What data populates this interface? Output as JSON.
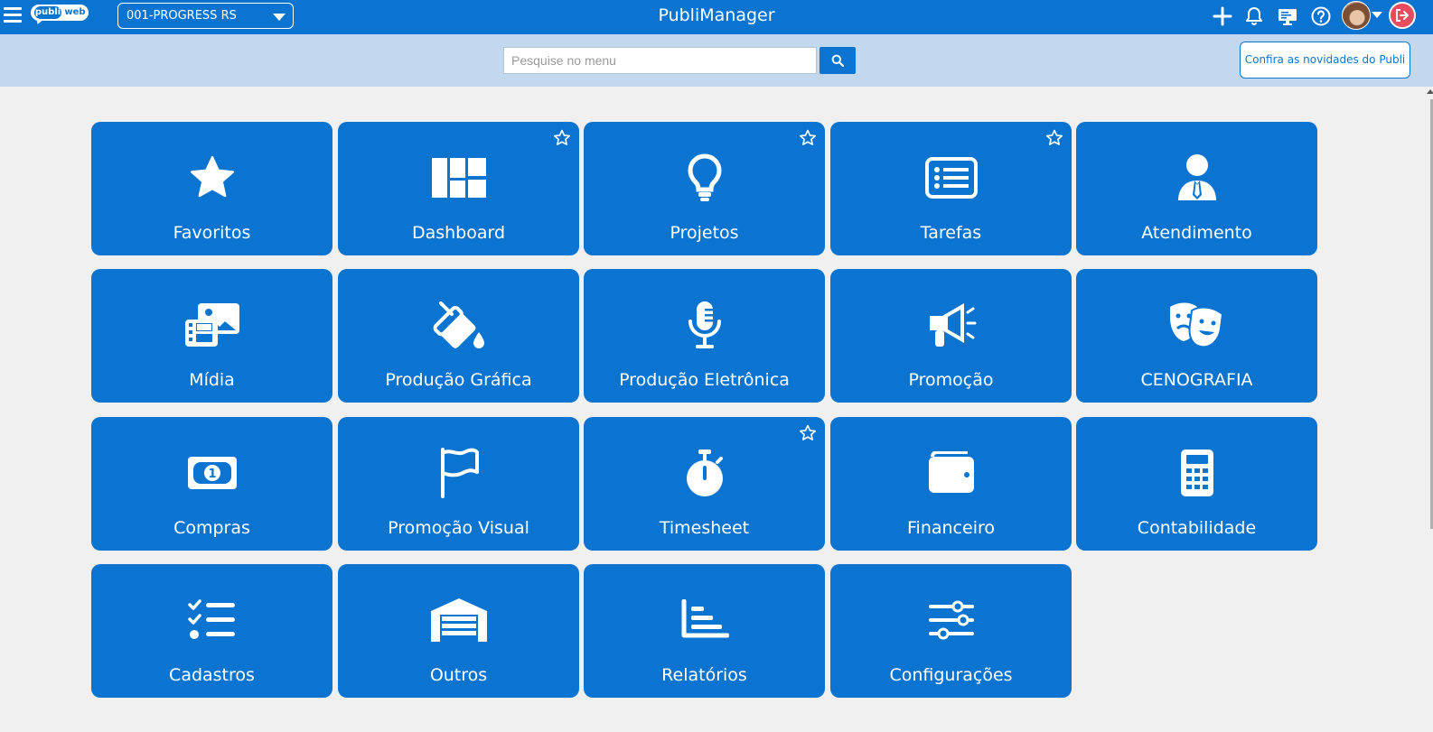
{
  "header": {
    "app_title": "PubliManager",
    "logo": {
      "part1": "publi",
      "part2": "web"
    },
    "company": "001-PROGRESS RS",
    "icons": [
      "menu-icon",
      "plus-icon",
      "bell-icon",
      "monitor-icon",
      "help-icon",
      "avatar",
      "logout-icon"
    ]
  },
  "search": {
    "placeholder": "Pesquise no menu",
    "value": ""
  },
  "news_button": "Confira as novidades do Publi",
  "colors": {
    "brand_blue": "#0a74d0",
    "search_band": "#c2d8ef",
    "background": "#f0f0f0",
    "logout_red": "#e74c5e"
  },
  "tiles": [
    {
      "label": "Favoritos",
      "icon": "star-icon",
      "favorited": false
    },
    {
      "label": "Dashboard",
      "icon": "dashboard-icon",
      "favorited": true
    },
    {
      "label": "Projetos",
      "icon": "lightbulb-icon",
      "favorited": true
    },
    {
      "label": "Tarefas",
      "icon": "list-icon",
      "favorited": true
    },
    {
      "label": "Atendimento",
      "icon": "user-tie-icon",
      "favorited": false
    },
    {
      "label": "Mídia",
      "icon": "photo-video-icon",
      "favorited": false
    },
    {
      "label": "Produção Gráfica",
      "icon": "fill-drip-icon",
      "favorited": false
    },
    {
      "label": "Produção Eletrônica",
      "icon": "microphone-icon",
      "favorited": false
    },
    {
      "label": "Promoção",
      "icon": "bullhorn-icon",
      "favorited": false
    },
    {
      "label": "CENOGRAFIA",
      "icon": "theater-masks-icon",
      "favorited": false
    },
    {
      "label": "Compras",
      "icon": "money-bill-icon",
      "favorited": false
    },
    {
      "label": "Promoção Visual",
      "icon": "flag-icon",
      "favorited": false
    },
    {
      "label": "Timesheet",
      "icon": "stopwatch-icon",
      "favorited": true
    },
    {
      "label": "Financeiro",
      "icon": "wallet-icon",
      "favorited": false
    },
    {
      "label": "Contabilidade",
      "icon": "calculator-icon",
      "favorited": false
    },
    {
      "label": "Cadastros",
      "icon": "tasks-icon",
      "favorited": false
    },
    {
      "label": "Outros",
      "icon": "warehouse-icon",
      "favorited": false
    },
    {
      "label": "Relatórios",
      "icon": "chart-bar-icon",
      "favorited": false
    },
    {
      "label": "Configurações",
      "icon": "sliders-icon",
      "favorited": false
    }
  ]
}
